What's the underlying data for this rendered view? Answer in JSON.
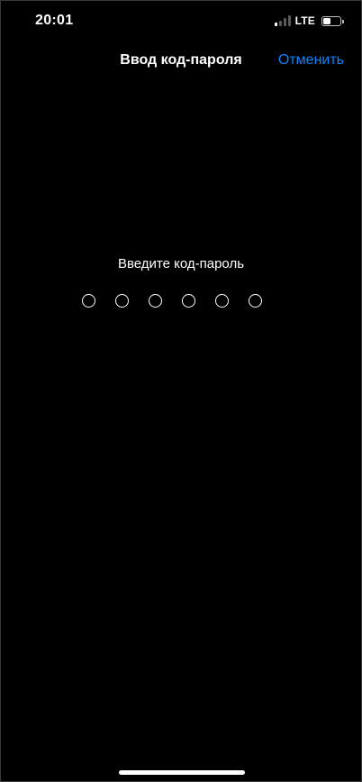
{
  "status_bar": {
    "time": "20:01",
    "network": "LTE",
    "signal_bars_active": 1,
    "signal_bars_total": 4,
    "battery_level": 0.45,
    "icons": [
      "cellular-signal-icon",
      "battery-icon"
    ]
  },
  "nav": {
    "title": "Ввод код-пароля",
    "cancel_label": "Отменить"
  },
  "passcode": {
    "prompt": "Введите код-пароль",
    "digits_total": 6,
    "digits_entered": 0
  },
  "colors": {
    "background": "#000000",
    "text": "#ffffff",
    "accent": "#0a84ff"
  }
}
